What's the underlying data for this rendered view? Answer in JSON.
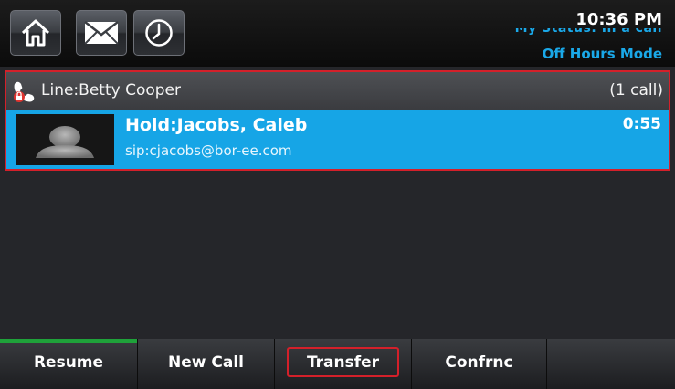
{
  "header": {
    "buttons": [
      {
        "name": "home",
        "icon": "home-icon"
      },
      {
        "name": "messages",
        "icon": "envelope-icon"
      },
      {
        "name": "recent-calls",
        "icon": "clock-icon"
      }
    ],
    "time": "10:36 PM",
    "status_line": "My Status: In a call",
    "mode": "Off Hours Mode"
  },
  "line": {
    "icon": "handset-icon",
    "label": "Line:Betty Cooper",
    "call_count": "(1 call)",
    "border_color": "#d4202a"
  },
  "call": {
    "name": "Hold:Jacobs, Caleb",
    "sip": "sip:cjacobs@bor-ee.com",
    "duration": "0:55",
    "avatar": "person-silhouette-icon",
    "highlight_color": "#16a5e6"
  },
  "softkeys": [
    {
      "label": "Resume",
      "active": true
    },
    {
      "label": "New Call"
    },
    {
      "label": "Transfer",
      "focused": true
    },
    {
      "label": "Confrnc"
    },
    {
      "label": ""
    }
  ]
}
